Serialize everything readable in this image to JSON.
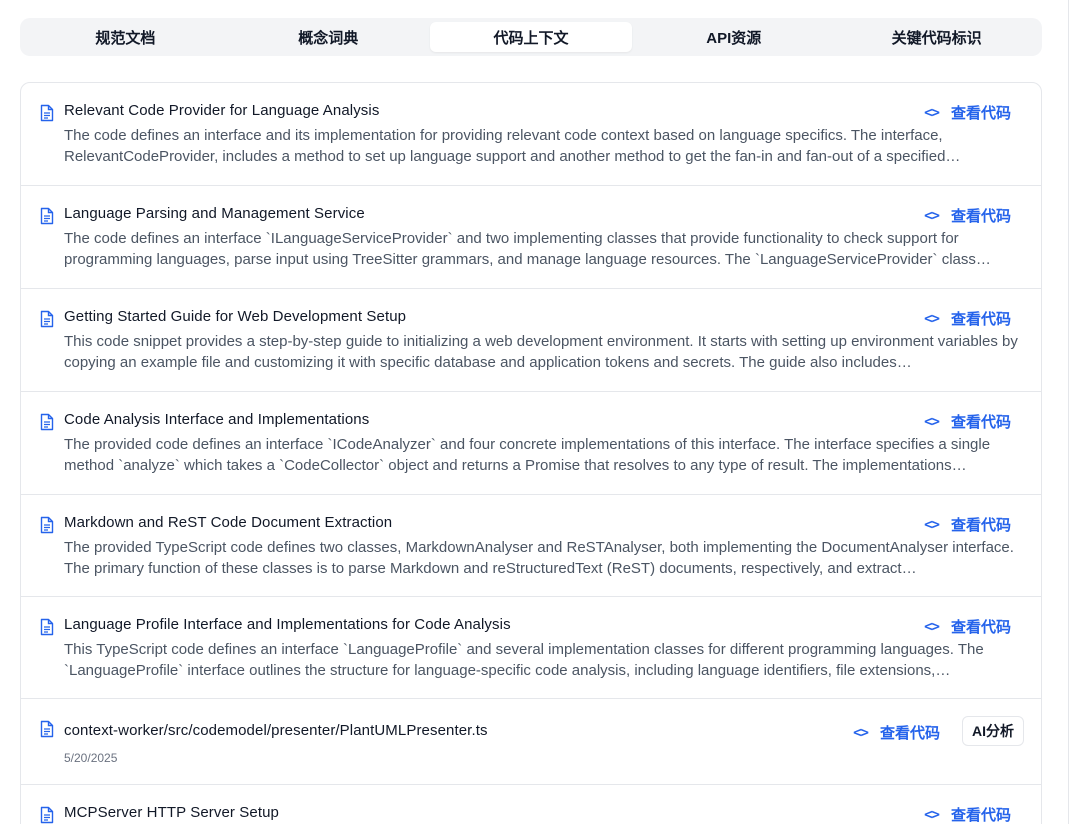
{
  "tabs": [
    "规范文档",
    "概念词典",
    "代码上下文",
    "API资源",
    "关键代码标识"
  ],
  "active_tab": "代码上下文",
  "view_code_label": "查看代码",
  "ai_label": "AI分析",
  "colors": {
    "accent": "#2563eb",
    "tab_bg": "#f3f4f6",
    "border": "#e5e7eb"
  },
  "icons": {
    "item": "document-icon",
    "view": "code-brackets-icon"
  },
  "results": [
    {
      "title": "Relevant Code Provider for Language Analysis",
      "description": "The code defines an interface and its implementation for providing relevant code context based on language specifics. The interface, RelevantCodeProvider, includes a method to set up language support and another method to get the fan-in and fan-out of a specified…"
    },
    {
      "title": "Language Parsing and Management Service",
      "description": "The code defines an interface `ILanguageServiceProvider` and two implementing classes that provide functionality to check support for programming languages, parse input using TreeSitter grammars, and manage language resources. The `LanguageServiceProvider` class…"
    },
    {
      "title": "Getting Started Guide for Web Development Setup",
      "description": "This code snippet provides a step-by-step guide to initializing a web development environment. It starts with setting up environment variables by copying an example file and customizing it with specific database and application tokens and secrets. The guide also includes…"
    },
    {
      "title": "Code Analysis Interface and Implementations",
      "description": "The provided code defines an interface `ICodeAnalyzer` and four concrete implementations of this interface. The interface specifies a single method `analyze` which takes a `CodeCollector` object and returns a Promise that resolves to any type of result. The implementations…"
    },
    {
      "title": "Markdown and ReST Code Document Extraction",
      "description": "The provided TypeScript code defines two classes, MarkdownAnalyser and ReSTAnalyser, both implementing the DocumentAnalyser interface. The primary function of these classes is to parse Markdown and reStructuredText (ReST) documents, respectively, and extract…"
    },
    {
      "title": "Language Profile Interface and Implementations for Code Analysis",
      "description": "This TypeScript code defines an interface `LanguageProfile` and several implementation classes for different programming languages. The `LanguageProfile` interface outlines the structure for language-specific code analysis, including language identifiers, file extensions,…"
    },
    {
      "title": "context-worker/src/codemodel/presenter/PlantUMLPresenter.ts",
      "date": "5/20/2025"
    },
    {
      "title": "MCPServer HTTP Server Setup"
    }
  ]
}
